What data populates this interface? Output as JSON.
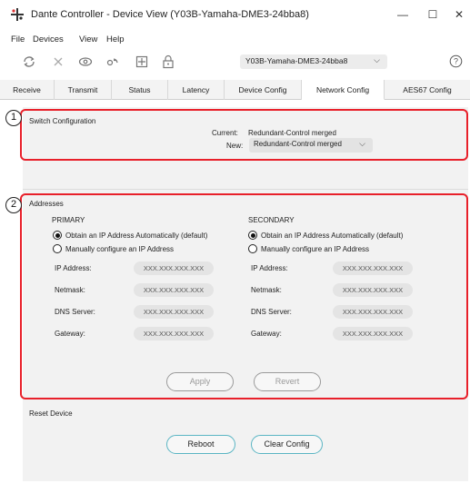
{
  "window": {
    "title": "Dante Controller - Device View (Y03B-Yamaha-DME3-24bba8)",
    "minimize": "—",
    "maximize": "☐",
    "close": "✕"
  },
  "menu": [
    "File",
    "Devices",
    "View",
    "Help"
  ],
  "toolbar": {
    "icons": [
      "refresh-icon",
      "disconnect-icon",
      "view-icon",
      "signal-icon",
      "add-icon",
      "lock-icon"
    ],
    "device_selected": "Y03B-Yamaha-DME3-24bba8",
    "help": "?"
  },
  "tabs": [
    "Receive",
    "Transmit",
    "Status",
    "Latency",
    "Device Config",
    "Network Config",
    "AES67 Config"
  ],
  "active_tab": "Network Config",
  "annotations": {
    "badge1": "1",
    "badge2": "2",
    "color": "#e8202a"
  },
  "switch_config": {
    "heading": "Switch Configuration",
    "current_label": "Current:",
    "current_value": "Redundant-Control merged",
    "new_label": "New:",
    "new_value": "Redundant-Control merged"
  },
  "addresses": {
    "heading": "Addresses",
    "primary": {
      "heading": "PRIMARY",
      "auto_label": "Obtain an IP Address Automatically (default)",
      "manual_label": "Manually configure an IP Address",
      "auto_selected": true,
      "fields": [
        {
          "label": "IP Address:",
          "value": "XXX.XXX.XXX.XXX"
        },
        {
          "label": "Netmask:",
          "value": "XXX.XXX.XXX.XXX"
        },
        {
          "label": "DNS Server:",
          "value": "XXX.XXX.XXX.XXX"
        },
        {
          "label": "Gateway:",
          "value": "XXX.XXX.XXX.XXX"
        }
      ]
    },
    "secondary": {
      "heading": "SECONDARY",
      "auto_label": "Obtain an IP Address Automatically (default)",
      "manual_label": "Manually configure an IP Address",
      "auto_selected": true,
      "fields": [
        {
          "label": "IP Address:",
          "value": "XXX.XXX.XXX.XXX"
        },
        {
          "label": "Netmask:",
          "value": "XXX.XXX.XXX.XXX"
        },
        {
          "label": "DNS Server:",
          "value": "XXX.XXX.XXX.XXX"
        },
        {
          "label": "Gateway:",
          "value": "XXX.XXX.XXX.XXX"
        }
      ]
    },
    "apply_label": "Apply",
    "revert_label": "Revert"
  },
  "reset_device": {
    "heading": "Reset Device",
    "reboot_label": "Reboot",
    "clear_label": "Clear Config"
  }
}
